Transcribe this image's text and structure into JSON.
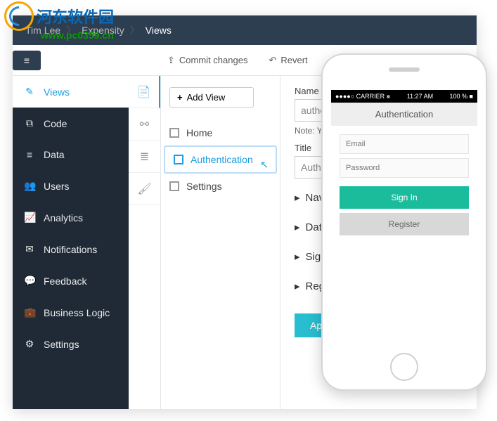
{
  "watermark": {
    "text": "河东软件园",
    "url": "www.pc0359.cn"
  },
  "breadcrumbs": {
    "user": "Tim Lee",
    "project": "Expensity",
    "page": "Views"
  },
  "toolbar": {
    "commit": "Commit changes",
    "revert": "Revert"
  },
  "sidebar": {
    "items": [
      {
        "label": "Views",
        "icon": "icon-edit",
        "active": true
      },
      {
        "label": "Code",
        "icon": "icon-code"
      },
      {
        "label": "Data",
        "icon": "icon-db"
      },
      {
        "label": "Users",
        "icon": "icon-users"
      },
      {
        "label": "Analytics",
        "icon": "icon-chart"
      },
      {
        "label": "Notifications",
        "icon": "icon-mail"
      },
      {
        "label": "Feedback",
        "icon": "icon-chat"
      },
      {
        "label": "Business Logic",
        "icon": "icon-brief"
      },
      {
        "label": "Settings",
        "icon": "icon-cog"
      }
    ]
  },
  "iconbar": [
    "icon-file",
    "icon-tree",
    "icon-stack",
    "icon-brush"
  ],
  "addView": {
    "label": "Add View"
  },
  "views": [
    {
      "label": "Home"
    },
    {
      "label": "Authentication",
      "active": true
    },
    {
      "label": "Settings"
    }
  ],
  "detail": {
    "nameLabel": "Name",
    "nameValue": "authent",
    "note": "Note: You c",
    "titleLabel": "Title",
    "titleValue": "Authent",
    "sections": [
      "Navi",
      "Data",
      "Sign",
      "Regi"
    ],
    "apply": "Apply"
  },
  "phone": {
    "status": {
      "carrier": "●●●●○ CARRIER ⨳",
      "time": "11:27 AM",
      "batt": "100 % ■"
    },
    "title": "Authentication",
    "emailPlaceholder": "Email",
    "passwordPlaceholder": "Password",
    "signIn": "Sign In",
    "register": "Register"
  }
}
